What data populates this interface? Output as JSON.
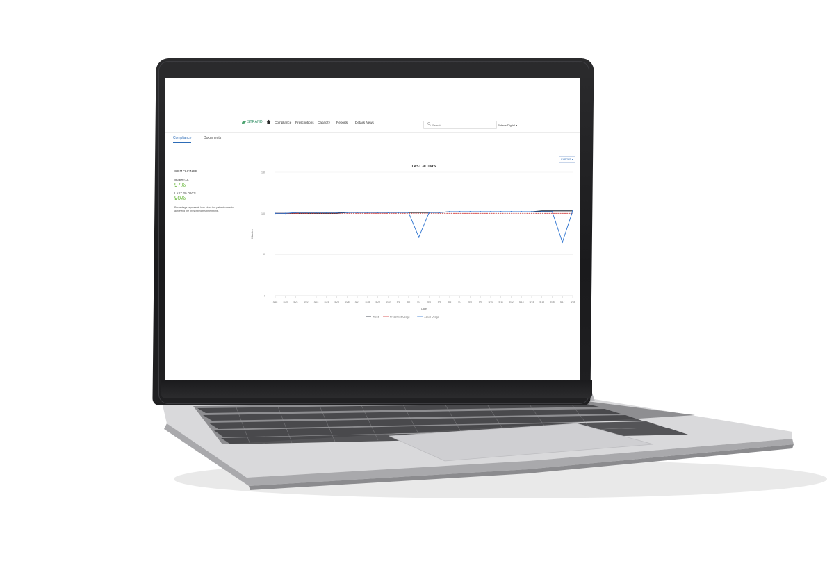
{
  "nav": {
    "brand": "STRAND",
    "items": [
      "Compliance",
      "Prescriptions",
      "Capacity",
      "Reports",
      "Details News"
    ],
    "search_placeholder": "Search",
    "user": "Ridene Digital"
  },
  "tabs": [
    "Compliance",
    "Documents"
  ],
  "export_label": "EXPORT",
  "summary": {
    "heading": "COMPLIANCE",
    "overall_label": "OVERALL",
    "overall_value": "97%",
    "last30_label": "LAST 30 DAYS",
    "last30_value": "90%",
    "note": "Percentage represents how close the patient came to achieving the prescribed treatment time."
  },
  "colors": {
    "accent": "#2d6cb7",
    "good": "#5fb22f",
    "trend": "#1f2733",
    "prescribed": "#d23b3b",
    "actual": "#2e74d0"
  },
  "chart_data": {
    "type": "line",
    "title": "LAST 30 DAYS",
    "xlabel": "Date",
    "ylabel": "Minutes",
    "ylim": [
      0,
      150
    ],
    "yticks": [
      0,
      50,
      100,
      150
    ],
    "categories": [
      "4/18",
      "4/20",
      "4/21",
      "4/22",
      "4/23",
      "4/24",
      "4/25",
      "4/26",
      "4/27",
      "4/28",
      "4/29",
      "4/30",
      "5/1",
      "5/2",
      "5/3",
      "5/4",
      "5/5",
      "5/6",
      "5/7",
      "5/8",
      "5/9",
      "5/10",
      "5/11",
      "5/12",
      "5/13",
      "5/14",
      "5/15",
      "5/16",
      "5/17",
      "5/18"
    ],
    "series": [
      {
        "name": "Trend",
        "values": [
          100,
          100,
          100,
          100,
          100,
          100,
          100,
          101,
          101,
          101,
          101,
          101,
          101,
          101,
          101,
          101,
          101,
          102,
          102,
          102,
          102,
          102,
          102,
          102,
          102,
          102,
          103,
          103,
          103,
          103
        ]
      },
      {
        "name": "Prescribed Usage",
        "values": [
          100,
          100,
          100,
          100,
          100,
          100,
          100,
          100,
          100,
          100,
          100,
          100,
          100,
          100,
          100,
          100,
          100,
          100,
          100,
          100,
          100,
          100,
          100,
          100,
          100,
          100,
          100,
          100,
          100,
          100
        ]
      },
      {
        "name": "Actual Usage",
        "values": [
          100,
          100,
          101,
          101,
          101,
          101,
          101,
          101,
          101,
          101,
          101,
          101,
          101,
          101,
          71,
          101,
          101,
          102,
          102,
          102,
          102,
          102,
          102,
          102,
          102,
          102,
          102,
          102,
          65,
          103
        ]
      }
    ],
    "grid": true,
    "legend": "bottom"
  }
}
